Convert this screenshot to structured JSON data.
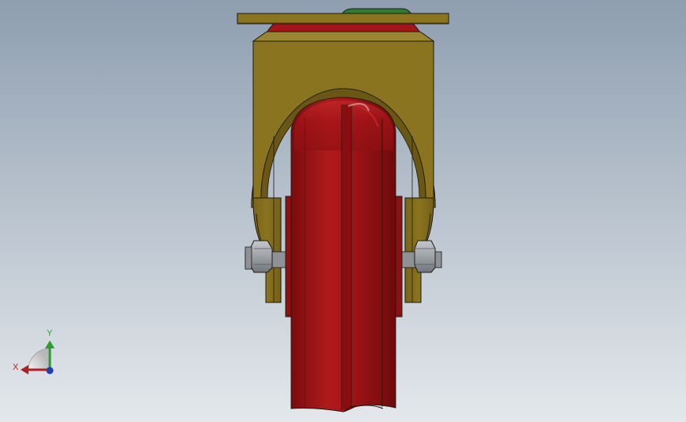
{
  "viewport": {
    "background_top": "#8e9eb0",
    "background_bottom": "#e4e8ec"
  },
  "model": {
    "name": "",
    "colors": {
      "bracket": "#8a7420",
      "bracket_dark": "#6a5714",
      "bracket_light": "#9c8530",
      "wheel": "#a51418",
      "wheel_dark": "#6e0a0c",
      "wheel_light": "#c42a2c",
      "plate_pad": "#2e7d32",
      "bolt": "#9ea2a6",
      "outline": "#1e1a10"
    }
  },
  "triad": {
    "x_label": "X",
    "y_label": "Y",
    "x_color": "#b02020",
    "y_color": "#2e9b2e",
    "z_color": "#1e3fb0"
  }
}
